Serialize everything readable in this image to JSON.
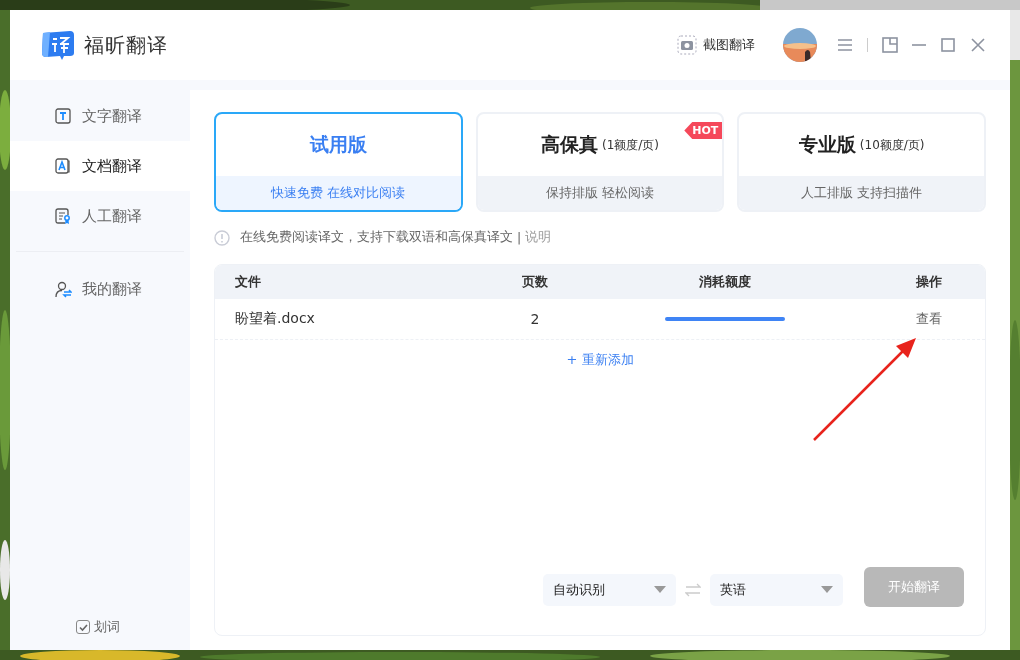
{
  "window": {
    "app_name": "福昕翻译",
    "screenshot_button": "截图翻译"
  },
  "sidebar": {
    "items": [
      {
        "label": "文字翻译",
        "selected": false
      },
      {
        "label": "文档翻译",
        "selected": true
      },
      {
        "label": "人工翻译",
        "selected": false
      },
      {
        "label": "我的翻译",
        "selected": false,
        "separated": true
      }
    ],
    "word_pick": {
      "label": "划词",
      "checked": true
    }
  },
  "plans": [
    {
      "name": "试用版",
      "subtitle": "快速免费 在线对比阅读",
      "selected": true
    },
    {
      "name": "高保真",
      "price": "(1额度/页)",
      "subtitle": "保持排版 轻松阅读",
      "badge": "HOT",
      "selected": false
    },
    {
      "name": "专业版",
      "price": "(10额度/页)",
      "subtitle": "人工排版 支持扫描件",
      "selected": false
    }
  ],
  "notice": {
    "text": "在线免费阅读译文，支持下载双语和高保真译文",
    "separator": "|",
    "link": "说明"
  },
  "table": {
    "columns": [
      "文件",
      "页数",
      "消耗额度",
      "操作"
    ],
    "rows": [
      {
        "file": "盼望着.docx",
        "pages": "2",
        "action": "查看"
      }
    ],
    "add_link": "+ 重新添加"
  },
  "translate": {
    "source": "自动识别",
    "target": "英语",
    "button": "开始翻译",
    "disabled": true
  },
  "annotation": {
    "kind": "arrow"
  }
}
